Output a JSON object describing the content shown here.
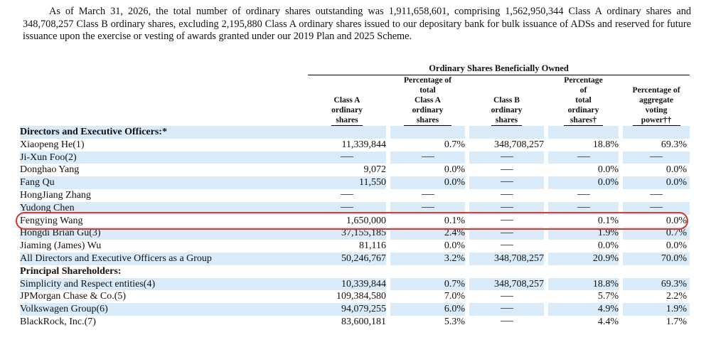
{
  "intro": "As of March 31, 2026, the total number of ordinary shares outstanding was 1,911,658,601, comprising 1,562,950,344 Class A ordinary shares and 348,708,257 Class B ordinary shares, excluding 2,195,880 Class A ordinary shares issued to our depositary bank for bulk issuance of ADSs and reserved for future issuance upon the exercise or vesting of awards granted under our 2019 Plan and 2025 Scheme.",
  "table": {
    "group_header": "Ordinary Shares Beneficially Owned",
    "columns": [
      [
        "Class A",
        "ordinary",
        "shares"
      ],
      [
        "Percentage of",
        "total",
        "Class A",
        "ordinary",
        "shares"
      ],
      [
        "Class B",
        "ordinary",
        "shares"
      ],
      [
        "Percentage",
        "of",
        "total",
        "ordinary",
        "shares†"
      ],
      [
        "Percentage of",
        "aggregate",
        "voting",
        "power††"
      ]
    ],
    "dash": "—",
    "rows": [
      {
        "type": "section",
        "name": "Directors and Executive Officers:*",
        "values": []
      },
      {
        "type": "data",
        "name": "Xiaopeng He(1)",
        "values": [
          "11,339,844",
          "0.7%",
          "348,708,257",
          "18.8%",
          "69.3%"
        ]
      },
      {
        "type": "data",
        "name": "Ji-Xun Foo(2)",
        "values": [
          "—",
          "—",
          "—",
          "—",
          "—"
        ]
      },
      {
        "type": "data",
        "name": "Donghao Yang",
        "values": [
          "9,072",
          "0.0%",
          "—",
          "0.0%",
          "0.0%"
        ]
      },
      {
        "type": "data",
        "name": "Fang Qu",
        "values": [
          "11,550",
          "0.0%",
          "—",
          "0.0%",
          "0.0%"
        ]
      },
      {
        "type": "data",
        "name": "HongJiang Zhang",
        "values": [
          "—",
          "—",
          "—",
          "—",
          "—"
        ]
      },
      {
        "type": "data",
        "name": "Yudong Chen",
        "values": [
          "—",
          "—",
          "—",
          "—",
          "—"
        ]
      },
      {
        "type": "data",
        "name": "Fengying Wang",
        "values": [
          "1,650,000",
          "0.1%",
          "—",
          "0.1%",
          "0.0%"
        ],
        "highlighted": true
      },
      {
        "type": "data",
        "name": "Hongdi Brian Gu(3)",
        "values": [
          "37,155,185",
          "2.4%",
          "—",
          "1.9%",
          "0.7%"
        ]
      },
      {
        "type": "data",
        "name": "Jiaming (James) Wu",
        "values": [
          "81,116",
          "0.0%",
          "—",
          "0.0%",
          "0.0%"
        ]
      },
      {
        "type": "data",
        "name": "All Directors and Executive Officers as a Group",
        "values": [
          "50,246,767",
          "3.2%",
          "348,708,257",
          "20.9%",
          "70.0%"
        ]
      },
      {
        "type": "section",
        "name": "Principal Shareholders:",
        "values": []
      },
      {
        "type": "data",
        "name": "Simplicity and Respect entities(4)",
        "values": [
          "10,339,844",
          "0.7%",
          "348,708,257",
          "18.8%",
          "69.3%"
        ]
      },
      {
        "type": "data",
        "name": "JPMorgan Chase & Co.(5)",
        "values": [
          "109,384,580",
          "7.0%",
          "—",
          "5.7%",
          "2.2%"
        ]
      },
      {
        "type": "data",
        "name": "Volkswagen Group(6)",
        "values": [
          "94,079,255",
          "6.0%",
          "—",
          "4.9%",
          "1.9%"
        ]
      },
      {
        "type": "data",
        "name": "BlackRock, Inc.(7)",
        "values": [
          "83,600,181",
          "5.3%",
          "—",
          "4.4%",
          "1.7%"
        ]
      }
    ]
  },
  "colors": {
    "row_shade": "#d9ebf8",
    "highlight": "#d63a2c"
  }
}
